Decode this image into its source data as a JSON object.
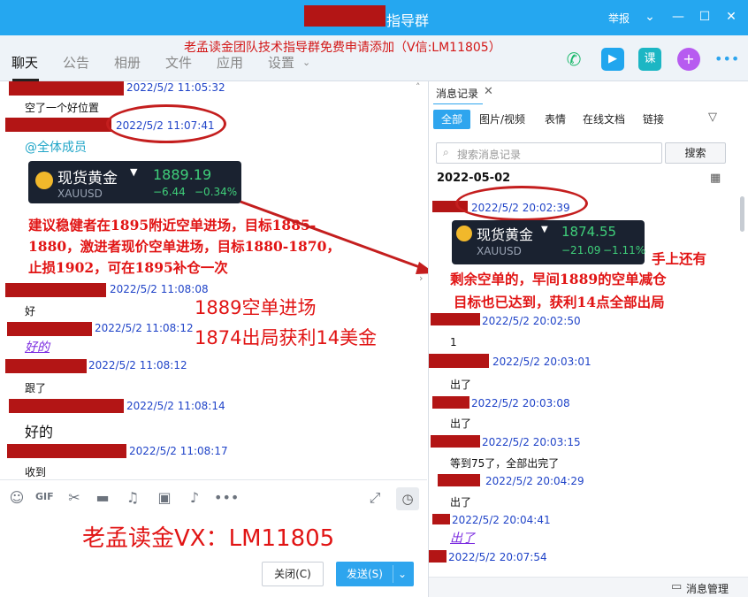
{
  "window": {
    "title": "指导群",
    "report": "举报",
    "banner": "老孟读金团队技术指导群免费申请添加（V信:LM11805）"
  },
  "tabs": [
    {
      "label": "聊天"
    },
    {
      "label": "公告"
    },
    {
      "label": "相册"
    },
    {
      "label": "文件"
    },
    {
      "label": "应用"
    },
    {
      "label": "设置"
    }
  ],
  "toolbar_icons": {
    "voice": "phone-icon",
    "video": "video-icon",
    "course": "课",
    "plus": "add-icon",
    "more": "more-icon"
  },
  "chat": {
    "messages": [
      {
        "time": "2022/5/2 11:05:32",
        "text": "空了一个好位置"
      },
      {
        "time": "2022/5/2 11:07:41",
        "text": "@全体成员"
      },
      {
        "time": "2022/5/2 11:08:08",
        "text": "好"
      },
      {
        "time": "2022/5/2 11:08:12",
        "text": "好的"
      },
      {
        "time": "2022/5/2 11:08:12",
        "text": "跟了"
      },
      {
        "time": "2022/5/2 11:08:14",
        "text": "好的"
      },
      {
        "time": "2022/5/2 11:08:17",
        "text": "收到"
      }
    ],
    "stock_card": {
      "name": "现货黄金",
      "price": "1889.19",
      "symbol": "XAUUSD",
      "change": "−6.44",
      "change_pct": "−0.34%"
    },
    "advice_lines": [
      "建议稳健者在1895附近空单进场，目标1885-",
      "1880，激进者现价空单进场，目标1880-1870，",
      "止损1902，可在1895补仓一次"
    ],
    "annotation_lines": [
      "1889空单进场",
      "1874出局获利14美金"
    ]
  },
  "input": {
    "footer": "老孟读金VX：LM11805",
    "close_label": "关闭(C)",
    "send_label": "发送(S)"
  },
  "history": {
    "tab_label": "消息记录",
    "filters": [
      "全部",
      "图片/视频",
      "表情",
      "在线文档",
      "链接"
    ],
    "search_placeholder": "搜索消息记录",
    "search_button": "搜索",
    "date": "2022-05-02",
    "stock_card": {
      "name": "现货黄金",
      "price": "1874.55",
      "symbol": "XAUUSD",
      "change": "−21.09",
      "change_pct": "−1.11%"
    },
    "annotation_lines": [
      "手上还有",
      "剩余空单的，早间1889的空单减仓",
      "目标也已达到，获利14点全部出局"
    ],
    "messages": [
      {
        "time": "2022/5/2 20:02:39",
        "text": ""
      },
      {
        "time": "2022/5/2 20:02:50",
        "text": "1"
      },
      {
        "time": "2022/5/2 20:03:01",
        "text": "出了"
      },
      {
        "time": "2022/5/2 20:03:08",
        "text": "出了"
      },
      {
        "time": "2022/5/2 20:03:15",
        "text": "等到75了，全部出完了"
      },
      {
        "time": "2022/5/2 20:04:29",
        "text": "出了"
      },
      {
        "time": "2022/5/2 20:04:41",
        "text": "出了"
      },
      {
        "time": "2022/5/2 20:07:54",
        "text": ""
      }
    ],
    "manage_label": "消息管理"
  },
  "colors": {
    "titlebar": "#25a7f0",
    "accent": "#2ea5ee",
    "redact": "#b31515",
    "annotation": "#e11414",
    "timestamp": "#2044c8"
  }
}
